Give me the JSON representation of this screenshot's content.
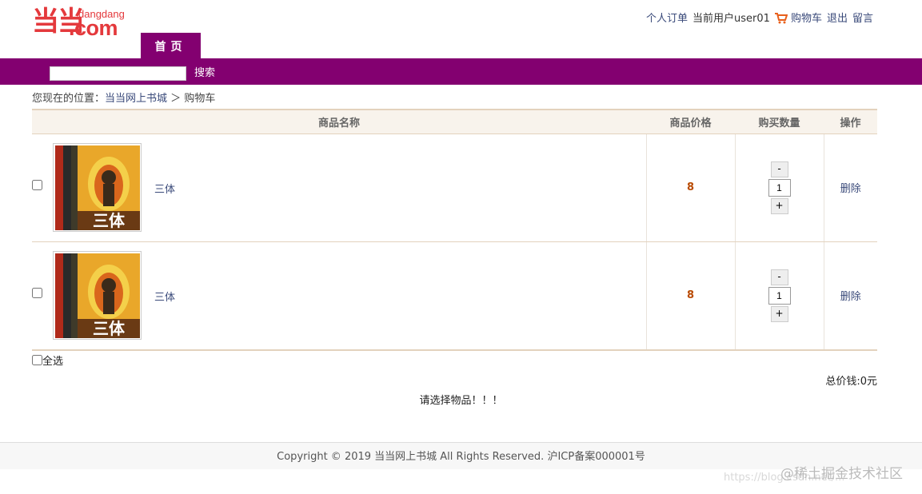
{
  "brand": {
    "logo_mark": "当当",
    "logo_small": "dangdang",
    "logo_domain": ".com",
    "color": "#830070"
  },
  "top_links": {
    "orders": "个人订单",
    "current_user": "当前用户user01",
    "cart": "购物车",
    "logout": "退出",
    "message": "留言"
  },
  "nav": {
    "home_tab": "首页"
  },
  "search": {
    "value": "",
    "button": "搜索"
  },
  "breadcrumb": {
    "prefix": "您现在的位置：",
    "home": "当当网上书城",
    "separator": "＞",
    "current": "购物车"
  },
  "cart": {
    "headers": {
      "name": "商品名称",
      "price": "商品价格",
      "quantity": "购买数量",
      "action": "操作"
    },
    "items": [
      {
        "name": "三体",
        "price": "8",
        "quantity": "1",
        "minus": "-",
        "plus": "+",
        "delete": "删除"
      },
      {
        "name": "三体",
        "price": "8",
        "quantity": "1",
        "minus": "-",
        "plus": "+",
        "delete": "删除"
      }
    ]
  },
  "select_all": "全选",
  "total": "总价钱:0元",
  "notice": "请选择物品！！！",
  "footer": "Copyright © 2019 当当网上书城 All Rights Reserved. 沪ICP备案000001号",
  "watermark": {
    "main": "@稀土掘金技术社区",
    "url": "https://blog.csdn.net/..."
  }
}
